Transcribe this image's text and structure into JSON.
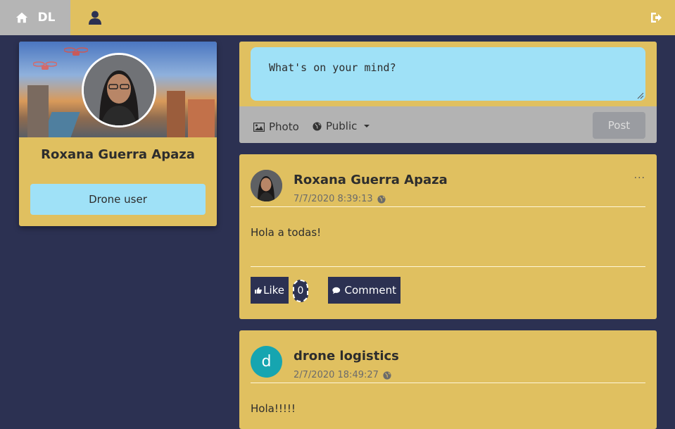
{
  "navbar": {
    "brand_label": "DL",
    "home_icon": "home-icon",
    "user_icon": "user-icon",
    "logout_icon": "sign-out-icon"
  },
  "profile": {
    "name": "Roxana Guerra Apaza",
    "role_label": "Drone user"
  },
  "composer": {
    "placeholder": "What's on your mind?",
    "photo_label": "Photo",
    "privacy_label": "Public",
    "post_label": "Post"
  },
  "posts": [
    {
      "author": "Roxana Guerra Apaza",
      "timestamp": "7/7/2020 8:39:13",
      "body": "Hola a todas!",
      "like_label": "Like",
      "like_count": "0",
      "comment_label": "Comment",
      "menu": "···"
    },
    {
      "author": "drone logistics",
      "avatar_letter": "d",
      "timestamp": "2/7/2020 18:49:27",
      "body": "Hola!!!!!"
    }
  ],
  "colors": {
    "background": "#2c3152",
    "card": "#e0c060",
    "accent": "#9fe1f7",
    "brand_bg": "#b5b5b5",
    "letter_avatar": "#16a5b0"
  }
}
